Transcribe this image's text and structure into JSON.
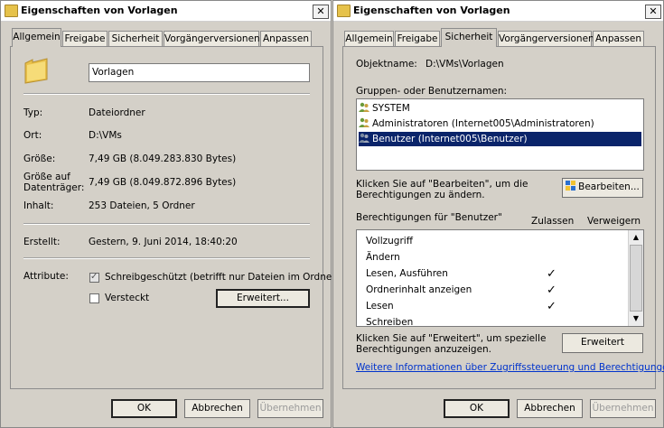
{
  "left": {
    "title": "Eigenschaften von Vorlagen",
    "close": "✕",
    "tabs": [
      "Allgemein",
      "Freigabe",
      "Sicherheit",
      "Vorgängerversionen",
      "Anpassen"
    ],
    "folder_name": "Vorlagen",
    "fields": {
      "typ_label": "Typ:",
      "typ_value": "Dateiordner",
      "ort_label": "Ort:",
      "ort_value": "D:\\VMs",
      "groesse_label": "Größe:",
      "groesse_value": "7,49 GB (8.049.283.830 Bytes)",
      "groesse_auf_label1": "Größe auf",
      "groesse_auf_label2": "Datenträger:",
      "groesse_auf_value": "7,49 GB (8.049.872.896 Bytes)",
      "inhalt_label": "Inhalt:",
      "inhalt_value": "253 Dateien, 5 Ordner",
      "erstellt_label": "Erstellt:",
      "erstellt_value": "Gestern, 9. Juni 2014, 18:40:20",
      "attribute_label": "Attribute:"
    },
    "readonly_label": "Schreibgeschützt (betrifft nur Dateien im Ordner)",
    "hidden_label": "Versteckt",
    "advanced_button": "Erweitert...",
    "ok": "OK",
    "cancel": "Abbrechen",
    "apply": "Übernehmen"
  },
  "right": {
    "title": "Eigenschaften von Vorlagen",
    "close": "✕",
    "tabs": [
      "Allgemein",
      "Freigabe",
      "Sicherheit",
      "Vorgängerversionen",
      "Anpassen"
    ],
    "objektname_label": "Objektname:",
    "objektname_value": "D:\\VMs\\Vorlagen",
    "groups_label": "Gruppen- oder Benutzernamen:",
    "users": [
      "SYSTEM",
      "Administratoren (Internet005\\Administratoren)",
      "Benutzer (Internet005\\Benutzer)"
    ],
    "edit_hint1": "Klicken Sie auf \"Bearbeiten\", um die",
    "edit_hint2": "Berechtigungen zu ändern.",
    "edit_button": "Bearbeiten...",
    "perm_label": "Berechtigungen für \"Benutzer\"",
    "allow_header": "Zulassen",
    "deny_header": "Verweigern",
    "permissions": [
      {
        "name": "Vollzugriff",
        "allow": false
      },
      {
        "name": "Ändern",
        "allow": false
      },
      {
        "name": "Lesen, Ausführen",
        "allow": true
      },
      {
        "name": "Ordnerinhalt anzeigen",
        "allow": true
      },
      {
        "name": "Lesen",
        "allow": true
      },
      {
        "name": "Schreiben",
        "allow": false
      }
    ],
    "tick": "✓",
    "adv_hint1": "Klicken Sie auf \"Erweitert\", um spezielle",
    "adv_hint2": "Berechtigungen anzuzeigen.",
    "advanced_button": "Erweitert",
    "link": "Weitere Informationen über Zugriffssteuerung und Berechtigungen",
    "ok": "OK",
    "cancel": "Abbrechen",
    "apply": "Übernehmen"
  }
}
